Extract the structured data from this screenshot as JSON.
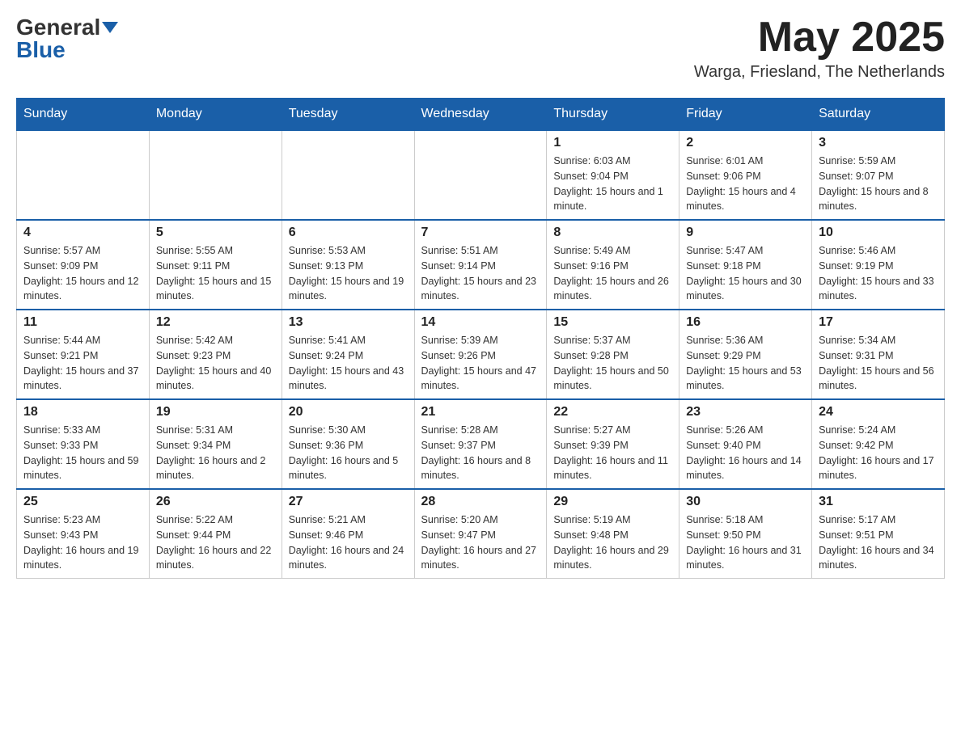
{
  "header": {
    "logo_general": "General",
    "logo_blue": "Blue",
    "month_year": "May 2025",
    "location": "Warga, Friesland, The Netherlands"
  },
  "days_of_week": [
    "Sunday",
    "Monday",
    "Tuesday",
    "Wednesday",
    "Thursday",
    "Friday",
    "Saturday"
  ],
  "weeks": [
    [
      {
        "day": "",
        "info": ""
      },
      {
        "day": "",
        "info": ""
      },
      {
        "day": "",
        "info": ""
      },
      {
        "day": "",
        "info": ""
      },
      {
        "day": "1",
        "info": "Sunrise: 6:03 AM\nSunset: 9:04 PM\nDaylight: 15 hours and 1 minute."
      },
      {
        "day": "2",
        "info": "Sunrise: 6:01 AM\nSunset: 9:06 PM\nDaylight: 15 hours and 4 minutes."
      },
      {
        "day": "3",
        "info": "Sunrise: 5:59 AM\nSunset: 9:07 PM\nDaylight: 15 hours and 8 minutes."
      }
    ],
    [
      {
        "day": "4",
        "info": "Sunrise: 5:57 AM\nSunset: 9:09 PM\nDaylight: 15 hours and 12 minutes."
      },
      {
        "day": "5",
        "info": "Sunrise: 5:55 AM\nSunset: 9:11 PM\nDaylight: 15 hours and 15 minutes."
      },
      {
        "day": "6",
        "info": "Sunrise: 5:53 AM\nSunset: 9:13 PM\nDaylight: 15 hours and 19 minutes."
      },
      {
        "day": "7",
        "info": "Sunrise: 5:51 AM\nSunset: 9:14 PM\nDaylight: 15 hours and 23 minutes."
      },
      {
        "day": "8",
        "info": "Sunrise: 5:49 AM\nSunset: 9:16 PM\nDaylight: 15 hours and 26 minutes."
      },
      {
        "day": "9",
        "info": "Sunrise: 5:47 AM\nSunset: 9:18 PM\nDaylight: 15 hours and 30 minutes."
      },
      {
        "day": "10",
        "info": "Sunrise: 5:46 AM\nSunset: 9:19 PM\nDaylight: 15 hours and 33 minutes."
      }
    ],
    [
      {
        "day": "11",
        "info": "Sunrise: 5:44 AM\nSunset: 9:21 PM\nDaylight: 15 hours and 37 minutes."
      },
      {
        "day": "12",
        "info": "Sunrise: 5:42 AM\nSunset: 9:23 PM\nDaylight: 15 hours and 40 minutes."
      },
      {
        "day": "13",
        "info": "Sunrise: 5:41 AM\nSunset: 9:24 PM\nDaylight: 15 hours and 43 minutes."
      },
      {
        "day": "14",
        "info": "Sunrise: 5:39 AM\nSunset: 9:26 PM\nDaylight: 15 hours and 47 minutes."
      },
      {
        "day": "15",
        "info": "Sunrise: 5:37 AM\nSunset: 9:28 PM\nDaylight: 15 hours and 50 minutes."
      },
      {
        "day": "16",
        "info": "Sunrise: 5:36 AM\nSunset: 9:29 PM\nDaylight: 15 hours and 53 minutes."
      },
      {
        "day": "17",
        "info": "Sunrise: 5:34 AM\nSunset: 9:31 PM\nDaylight: 15 hours and 56 minutes."
      }
    ],
    [
      {
        "day": "18",
        "info": "Sunrise: 5:33 AM\nSunset: 9:33 PM\nDaylight: 15 hours and 59 minutes."
      },
      {
        "day": "19",
        "info": "Sunrise: 5:31 AM\nSunset: 9:34 PM\nDaylight: 16 hours and 2 minutes."
      },
      {
        "day": "20",
        "info": "Sunrise: 5:30 AM\nSunset: 9:36 PM\nDaylight: 16 hours and 5 minutes."
      },
      {
        "day": "21",
        "info": "Sunrise: 5:28 AM\nSunset: 9:37 PM\nDaylight: 16 hours and 8 minutes."
      },
      {
        "day": "22",
        "info": "Sunrise: 5:27 AM\nSunset: 9:39 PM\nDaylight: 16 hours and 11 minutes."
      },
      {
        "day": "23",
        "info": "Sunrise: 5:26 AM\nSunset: 9:40 PM\nDaylight: 16 hours and 14 minutes."
      },
      {
        "day": "24",
        "info": "Sunrise: 5:24 AM\nSunset: 9:42 PM\nDaylight: 16 hours and 17 minutes."
      }
    ],
    [
      {
        "day": "25",
        "info": "Sunrise: 5:23 AM\nSunset: 9:43 PM\nDaylight: 16 hours and 19 minutes."
      },
      {
        "day": "26",
        "info": "Sunrise: 5:22 AM\nSunset: 9:44 PM\nDaylight: 16 hours and 22 minutes."
      },
      {
        "day": "27",
        "info": "Sunrise: 5:21 AM\nSunset: 9:46 PM\nDaylight: 16 hours and 24 minutes."
      },
      {
        "day": "28",
        "info": "Sunrise: 5:20 AM\nSunset: 9:47 PM\nDaylight: 16 hours and 27 minutes."
      },
      {
        "day": "29",
        "info": "Sunrise: 5:19 AM\nSunset: 9:48 PM\nDaylight: 16 hours and 29 minutes."
      },
      {
        "day": "30",
        "info": "Sunrise: 5:18 AM\nSunset: 9:50 PM\nDaylight: 16 hours and 31 minutes."
      },
      {
        "day": "31",
        "info": "Sunrise: 5:17 AM\nSunset: 9:51 PM\nDaylight: 16 hours and 34 minutes."
      }
    ]
  ]
}
